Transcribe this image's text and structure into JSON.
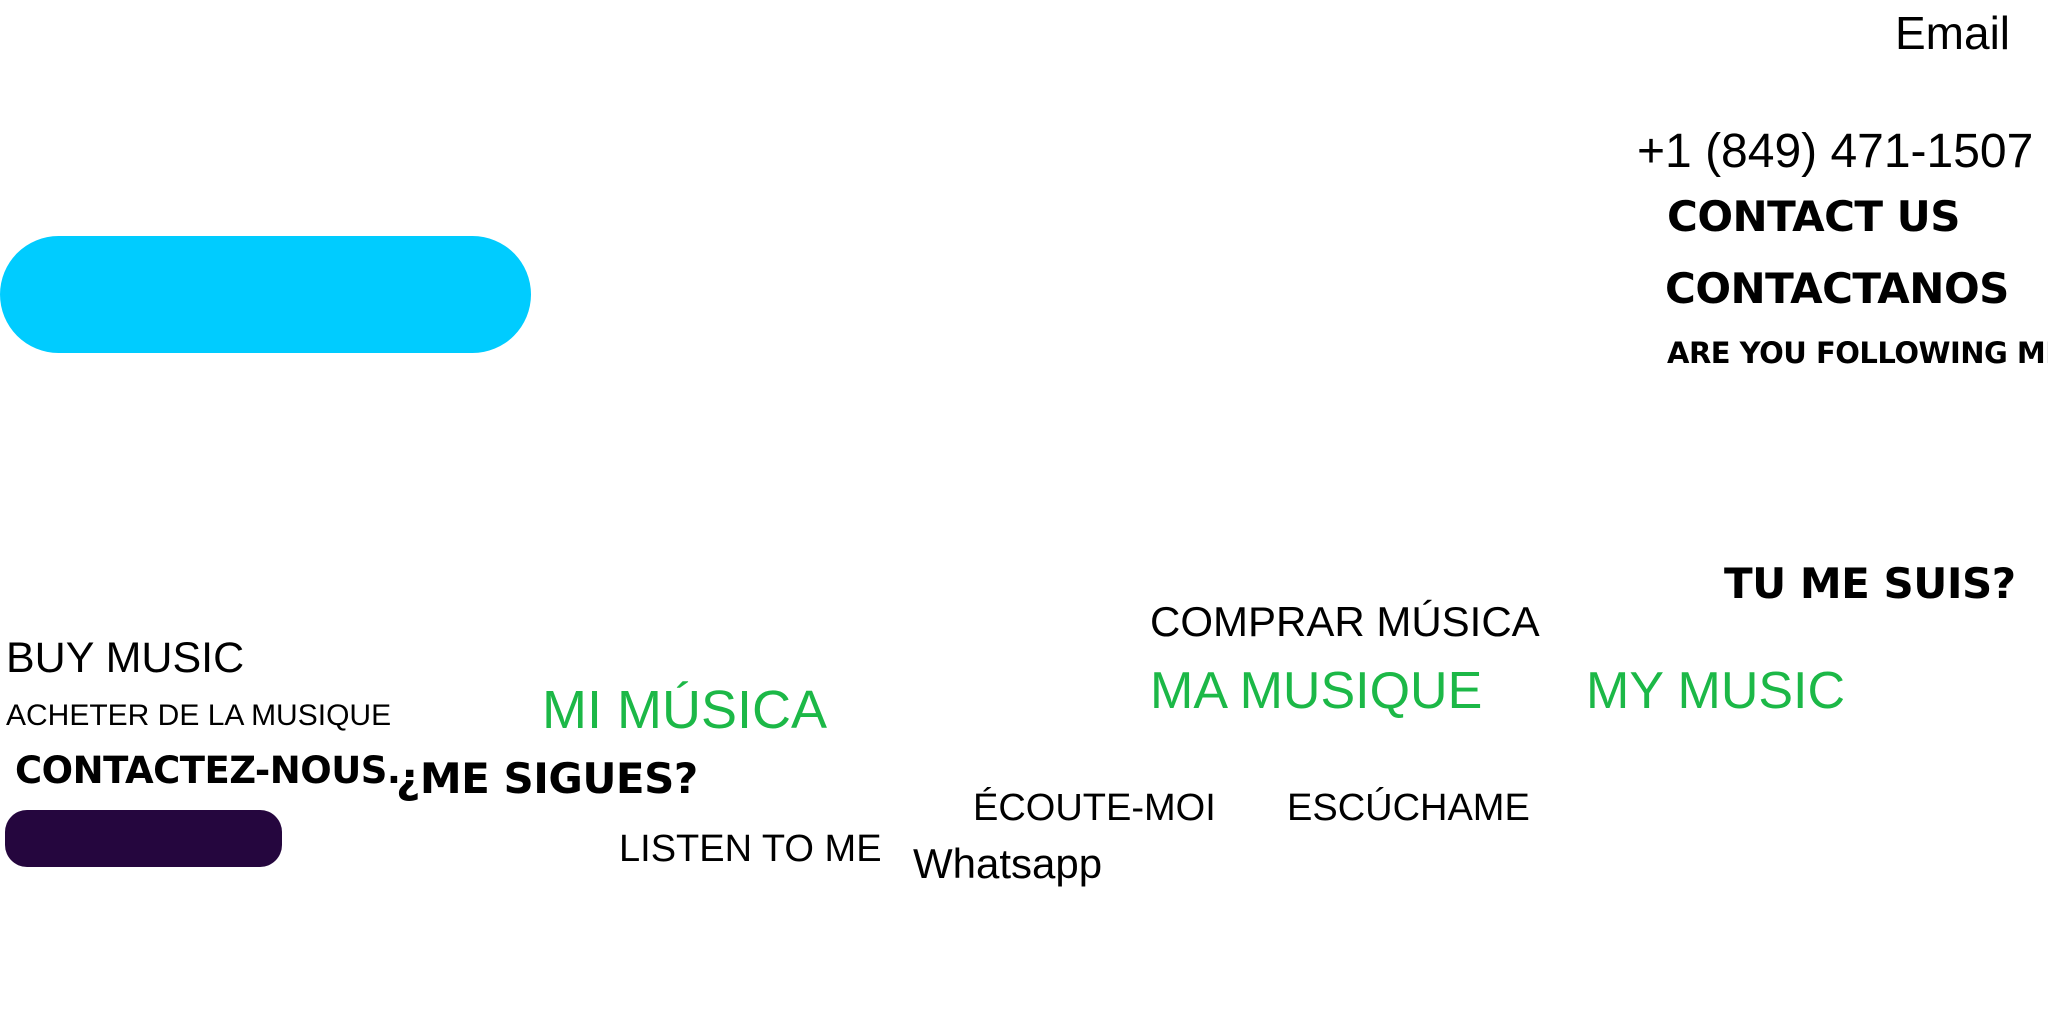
{
  "contact": {
    "email_label": "Email",
    "phone": "+1 (849) 471-1507",
    "contact_us": "CONTACT US",
    "contactanos": "CONTACTANOS",
    "are_you_following": "ARE YOU FOLLOWING ME?"
  },
  "colors": {
    "cyan_pill": "#00ccff",
    "navy_pill": "#25063e",
    "green_text": "#1cb847"
  },
  "music": {
    "tu_me_suis": "TU ME SUIS?",
    "comprar_musica": "COMPRAR MÚSICA",
    "ma_musique": "MA MUSIQUE",
    "my_music": "MY MUSIC",
    "buy_music": "BUY MUSIC",
    "acheter": "ACHETER DE LA MUSIQUE",
    "mi_musica": "MI MÚSICA"
  },
  "follow": {
    "contactez_nous": "CONTACTEZ-NOUS.",
    "me_sigues": "¿ME SIGUES?"
  },
  "listen": {
    "ecoute_moi": "ÉCOUTE-MOI",
    "escuchame": "ESCÚCHAME",
    "listen_to_me": "LISTEN TO ME",
    "whatsapp": "Whatsapp"
  }
}
